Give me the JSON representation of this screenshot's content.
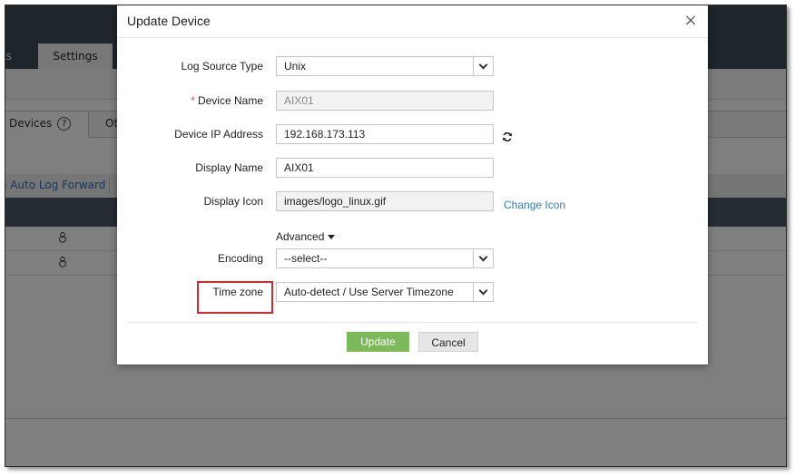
{
  "background": {
    "tab_prev": "ts",
    "tab_active": "Settings",
    "tab_devices": "Devices",
    "help_icon": "?",
    "tab_other": "Ot",
    "link_auto_log_forward": "e Auto Log Forward",
    "row_icon": "linux-tux-icon"
  },
  "dialog": {
    "title": "Update Device",
    "close_icon": "×",
    "fields": {
      "log_source_type": {
        "label": "Log Source Type",
        "value": "Unix"
      },
      "device_name": {
        "required": "*",
        "label": "Device Name",
        "value": "AIX01"
      },
      "device_ip": {
        "label": "Device IP Address",
        "value": "192.168.173.113"
      },
      "display_name": {
        "label": "Display Name",
        "value": "AIX01"
      },
      "display_icon": {
        "label": "Display Icon",
        "value": "images/logo_linux.gif",
        "change_link": "Change Icon"
      },
      "advanced": "Advanced",
      "encoding": {
        "label": "Encoding",
        "value": "--select--"
      },
      "time_zone": {
        "label": "Time zone",
        "value": "Auto-detect / Use Server Timezone"
      }
    },
    "buttons": {
      "update": "Update",
      "cancel": "Cancel"
    }
  },
  "colors": {
    "update_button": "#7cb95a",
    "highlight": "#d9282f",
    "link": "#2e7bc4",
    "topbar": "#3d4a56"
  }
}
